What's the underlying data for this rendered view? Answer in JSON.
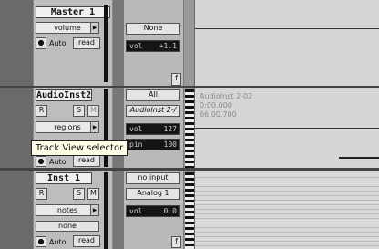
{
  "tracks": [
    {
      "name": "Master 1",
      "view": "volume",
      "automation_mode": "Auto",
      "automation_state": "read",
      "io_input": "None",
      "io_label": "vol",
      "io_value": "+1.1"
    },
    {
      "name": "AudioInst2",
      "record_button": "R",
      "solo_button": "S",
      "mute_button": "M",
      "view": "regions",
      "automation_mode": "Auto",
      "automation_state": "read",
      "io_input": "All",
      "io_output": "AudioInst 2-/",
      "vol_label": "vol",
      "vol_value": "127",
      "pan_label": "pin",
      "pan_value": "100",
      "region_name": "AudioInst 2-02",
      "region_start": "0:00.000",
      "region_end": "66.00.700"
    },
    {
      "name": "Inst 1",
      "record_button": "R",
      "solo_button": "S",
      "mute_button": "M",
      "view": "notes",
      "extra": "none",
      "automation_mode": "Auto",
      "automation_state": "read",
      "io_input": "no input",
      "io_output": "Analog 1",
      "vol_label": "vol",
      "vol_value": "0.0"
    }
  ],
  "tooltip": "Track View selector",
  "ruler_marker": "f"
}
